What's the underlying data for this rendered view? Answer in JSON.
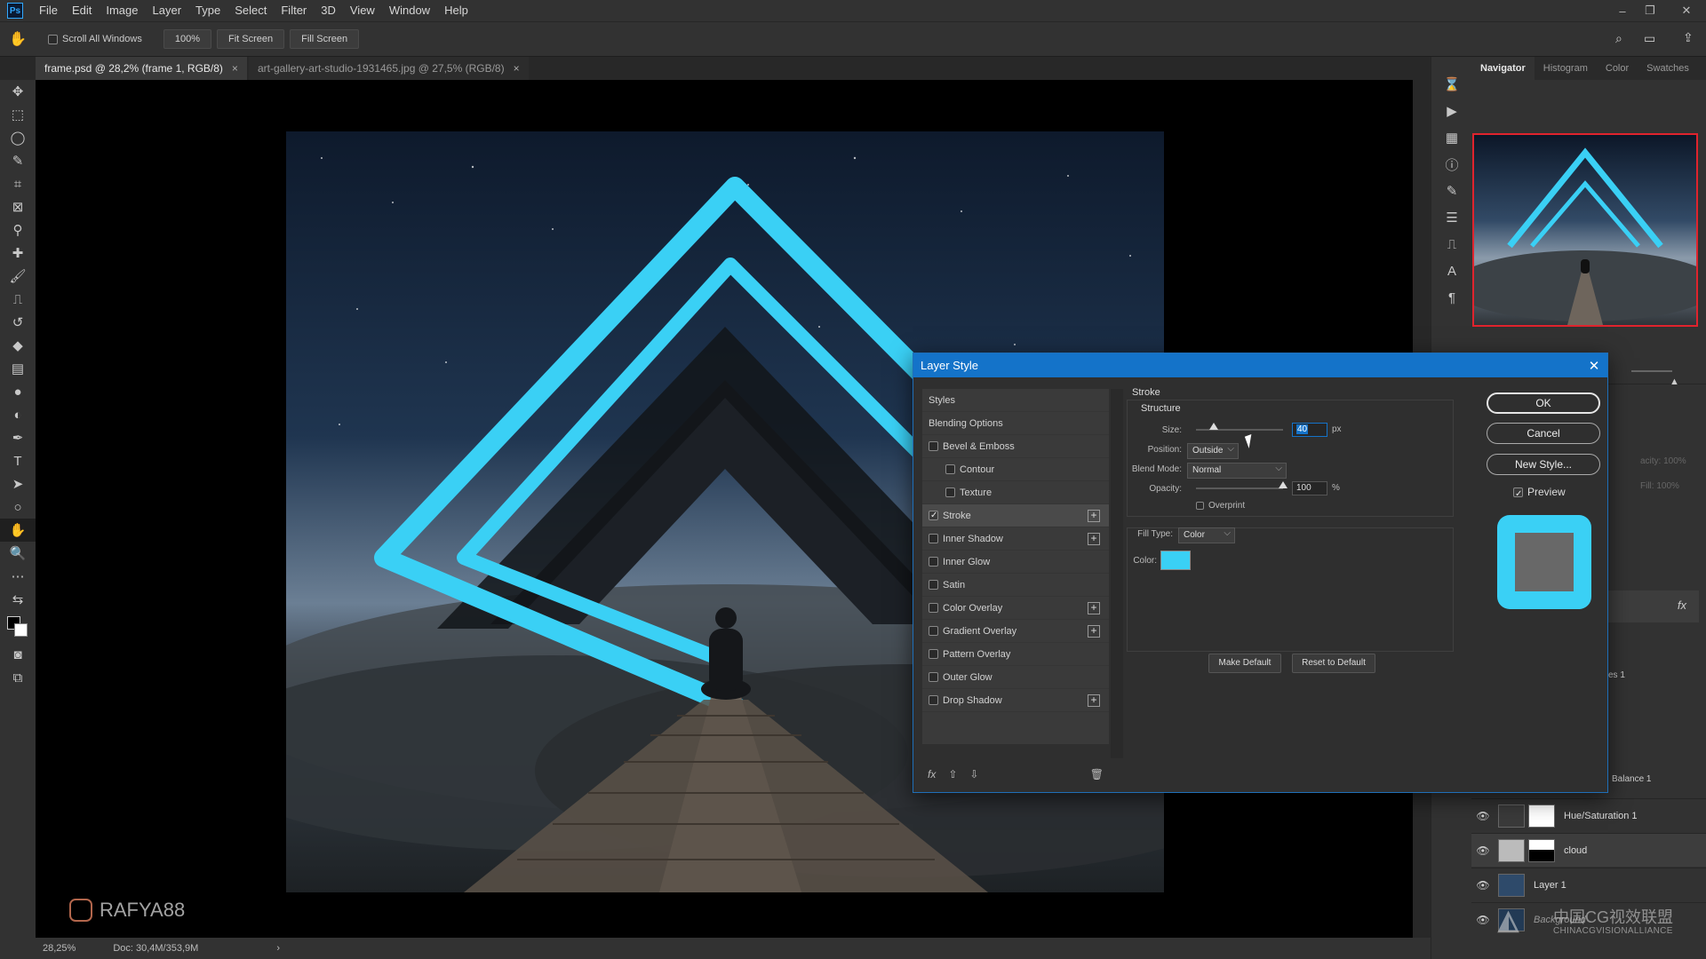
{
  "app": {
    "logo": "Ps"
  },
  "menu": [
    "File",
    "Edit",
    "Image",
    "Layer",
    "Type",
    "Select",
    "Filter",
    "3D",
    "View",
    "Window",
    "Help"
  ],
  "options": {
    "scroll_all_label": "Scroll All Windows",
    "zoom_button": "100%",
    "fit_screen": "Fit Screen",
    "fill_screen": "Fill Screen"
  },
  "tabs": [
    {
      "label": "frame.psd @ 28,2% (frame 1, RGB/8)",
      "close": "×"
    },
    {
      "label": "art-gallery-art-studio-1931465.jpg @ 27,5% (RGB/8)",
      "close": "×"
    }
  ],
  "panels": {
    "tabs": [
      "Navigator",
      "Histogram",
      "Color",
      "Swatches"
    ]
  },
  "layers": {
    "partial_labels": {
      "opacity": "acity: 100%",
      "fill": "Fill: 100%",
      "es1": "es 1",
      "balance": "Balance 1"
    },
    "rows": [
      {
        "name": "Hue/Saturation 1",
        "eye": "👁"
      },
      {
        "name": "cloud",
        "eye": "👁"
      },
      {
        "name": "Layer 1",
        "eye": "👁"
      },
      {
        "name": "Background",
        "eye": "👁"
      }
    ]
  },
  "status": {
    "zoom": "28,25%",
    "doc": "Doc: 30,4M/353,9M",
    "arrow": "›"
  },
  "watermark": {
    "handle": "RAFYA88",
    "logo_cn": "中国CG视效联盟",
    "logo_en": "CHINACGVISIONALLIANCE"
  },
  "dialog": {
    "title": "Layer Style",
    "close": "✕",
    "styles_header": "Styles",
    "blending_options": "Blending Options",
    "items": [
      {
        "label": "Bevel & Emboss",
        "checked": false,
        "sub": false,
        "plus": false
      },
      {
        "label": "Contour",
        "checked": false,
        "sub": true,
        "plus": false
      },
      {
        "label": "Texture",
        "checked": false,
        "sub": true,
        "plus": false
      },
      {
        "label": "Stroke",
        "checked": true,
        "sub": false,
        "plus": true
      },
      {
        "label": "Inner Shadow",
        "checked": false,
        "sub": false,
        "plus": true
      },
      {
        "label": "Inner Glow",
        "checked": false,
        "sub": false,
        "plus": false
      },
      {
        "label": "Satin",
        "checked": false,
        "sub": false,
        "plus": false
      },
      {
        "label": "Color Overlay",
        "checked": false,
        "sub": false,
        "plus": true
      },
      {
        "label": "Gradient Overlay",
        "checked": false,
        "sub": false,
        "plus": true
      },
      {
        "label": "Pattern Overlay",
        "checked": false,
        "sub": false,
        "plus": false
      },
      {
        "label": "Outer Glow",
        "checked": false,
        "sub": false,
        "plus": false
      },
      {
        "label": "Drop Shadow",
        "checked": false,
        "sub": false,
        "plus": true
      }
    ],
    "fx_label": "fx",
    "stroke": {
      "section": "Stroke",
      "structure": "Structure",
      "size_label": "Size:",
      "size_value": "40",
      "size_unit": "px",
      "position_label": "Position:",
      "position_value": "Outside",
      "blend_label": "Blend Mode:",
      "blend_value": "Normal",
      "opacity_label": "Opacity:",
      "opacity_value": "100",
      "opacity_unit": "%",
      "overprint_label": "Overprint",
      "filltype_label": "Fill Type:",
      "filltype_value": "Color",
      "color_label": "Color:",
      "color_hex": "#3ad0f5",
      "make_default": "Make Default",
      "reset_default": "Reset to Default"
    },
    "buttons": {
      "ok": "OK",
      "cancel": "Cancel",
      "new_style": "New Style...",
      "preview_label": "Preview"
    }
  },
  "colors": {
    "accent": "#1473c9",
    "stroke": "#3ad0f5",
    "nav_frame": "#e0232d"
  }
}
